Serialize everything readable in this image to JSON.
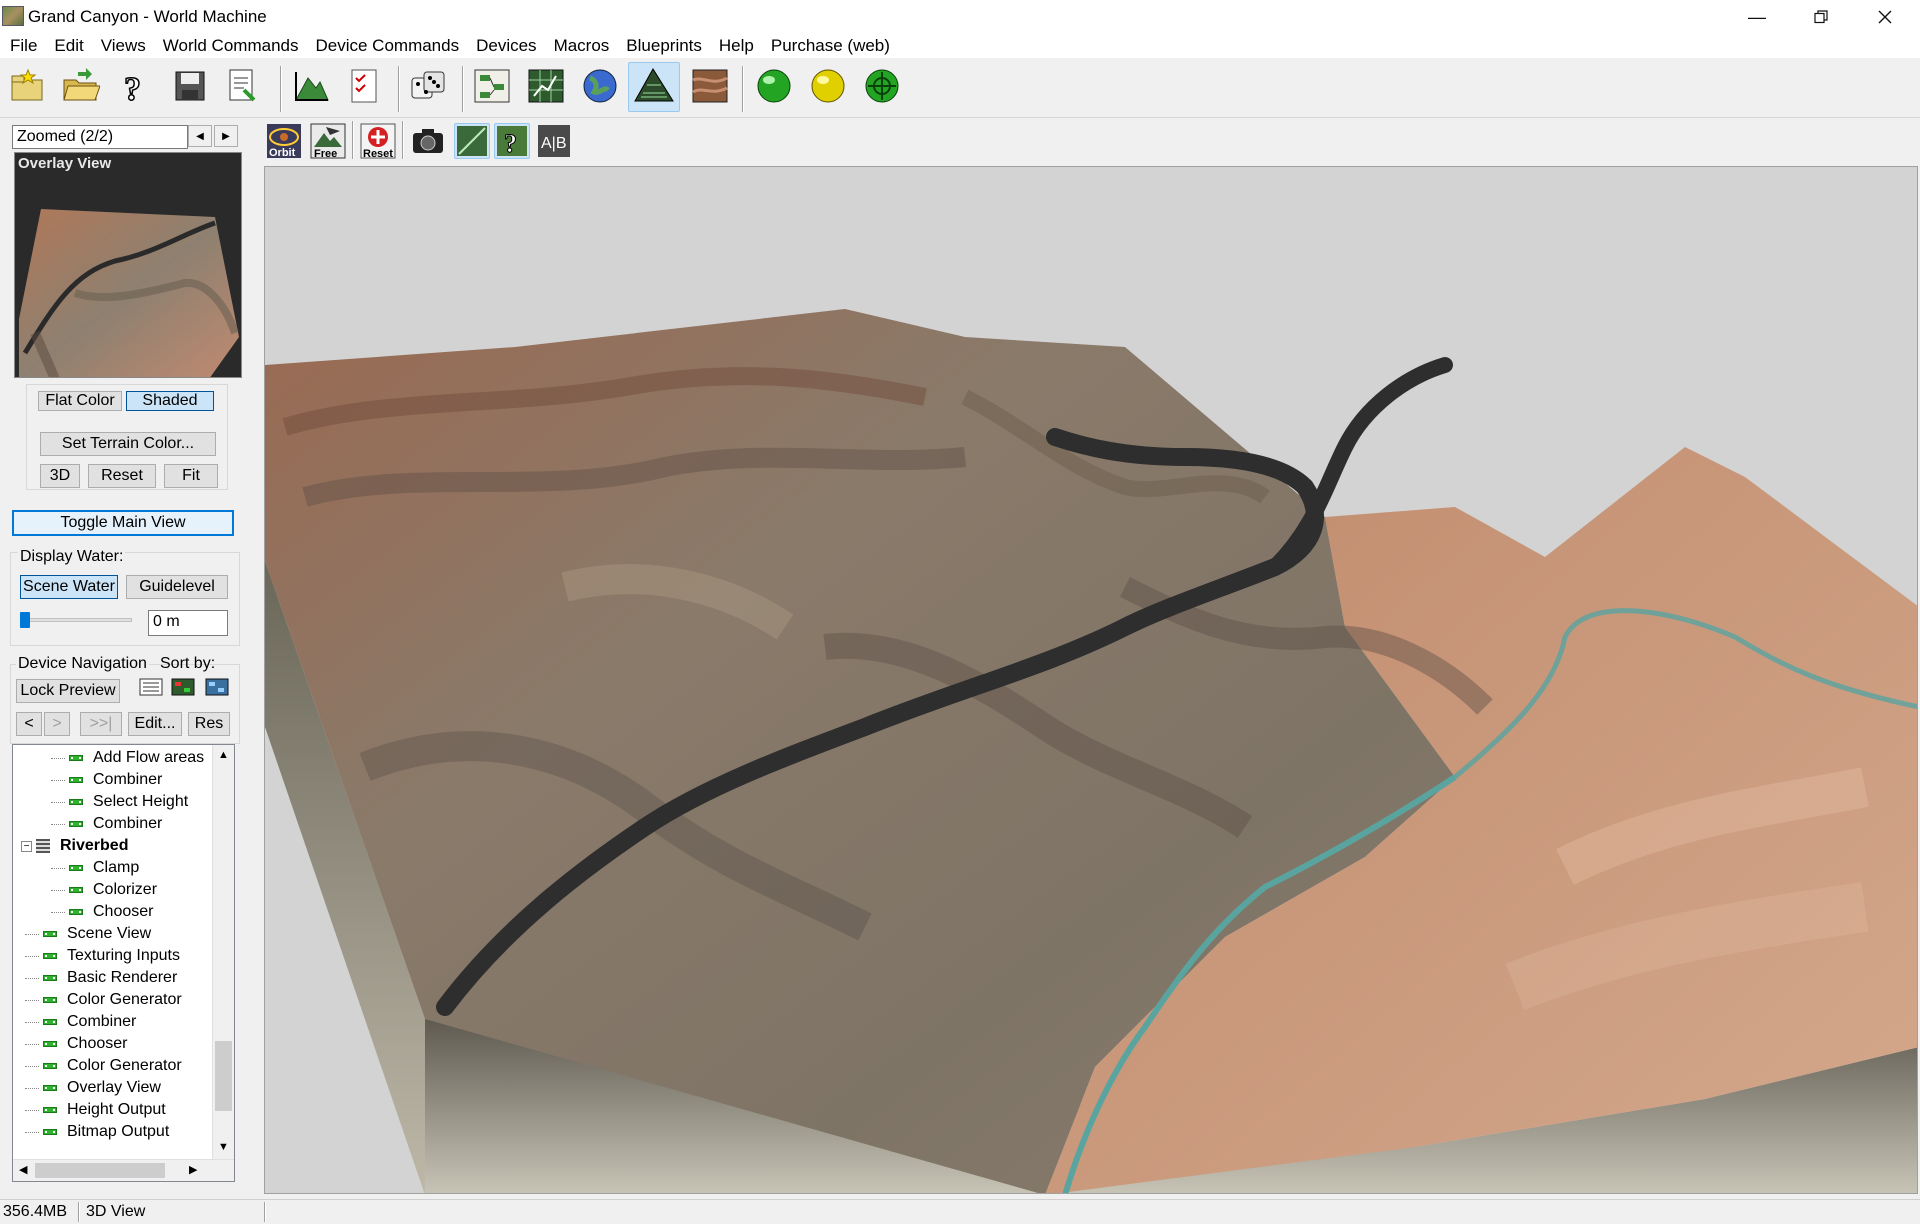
{
  "window": {
    "title": "Grand Canyon - World Machine"
  },
  "menu": [
    "File",
    "Edit",
    "Views",
    "World Commands",
    "Device Commands",
    "Devices",
    "Macros",
    "Blueprints",
    "Help",
    "Purchase (web)"
  ],
  "view_toolbar": {
    "orbit_label": "Orbit",
    "free_label": "Free",
    "reset_label": "Reset",
    "ab_label": "A|B"
  },
  "left_panel": {
    "view_selector": "Zoomed (2/2)",
    "overlay_title": "Overlay View",
    "flat_color": "Flat Color",
    "shaded": "Shaded",
    "set_terrain_color": "Set Terrain Color...",
    "btn_3d": "3D",
    "btn_reset": "Reset",
    "btn_fit": "Fit",
    "toggle_main_view": "Toggle Main View",
    "display_water": "Display Water:",
    "scene_water": "Scene Water",
    "guidelevel": "Guidelevel",
    "water_level": "0 m",
    "device_navigation": "Device Navigation",
    "sort_by": "Sort by:",
    "lock_preview": "Lock Preview",
    "nav_back": "<",
    "nav_fwd": ">",
    "nav_end": ">>|",
    "edit": "Edit...",
    "res": "Res"
  },
  "tree_items": [
    {
      "label": "Add Flow areas",
      "level": 2,
      "bold": false
    },
    {
      "label": "Combiner",
      "level": 2,
      "bold": false
    },
    {
      "label": "Select Height",
      "level": 2,
      "bold": false
    },
    {
      "label": "Combiner",
      "level": 2,
      "bold": false
    },
    {
      "label": "Riverbed",
      "level": 1,
      "bold": true
    },
    {
      "label": "Clamp",
      "level": 2,
      "bold": false
    },
    {
      "label": "Colorizer",
      "level": 2,
      "bold": false
    },
    {
      "label": "Chooser",
      "level": 2,
      "bold": false
    },
    {
      "label": "Scene View",
      "level": 1,
      "bold": false
    },
    {
      "label": "Texturing Inputs",
      "level": 1,
      "bold": false
    },
    {
      "label": "Basic Renderer",
      "level": 1,
      "bold": false
    },
    {
      "label": "Color Generator",
      "level": 1,
      "bold": false
    },
    {
      "label": "Combiner",
      "level": 1,
      "bold": false
    },
    {
      "label": "Chooser",
      "level": 1,
      "bold": false
    },
    {
      "label": "Color Generator",
      "level": 1,
      "bold": false
    },
    {
      "label": "Overlay View",
      "level": 1,
      "bold": false
    },
    {
      "label": "Height Output",
      "level": 1,
      "bold": false
    },
    {
      "label": "Bitmap Output",
      "level": 1,
      "bold": false
    }
  ],
  "status": {
    "memory": "356.4MB",
    "view": "3D View"
  },
  "icons": [
    "new-project-icon",
    "open-icon",
    "help-icon",
    "save-icon",
    "export-icon",
    "terrain-build-icon",
    "checklist-icon",
    "random-seed-icon",
    "layout-view-icon",
    "device-view-icon",
    "globe-icon",
    "3d-view-icon",
    "texture-view-icon",
    "build-green-icon",
    "build-yellow-icon",
    "build-target-icon"
  ]
}
